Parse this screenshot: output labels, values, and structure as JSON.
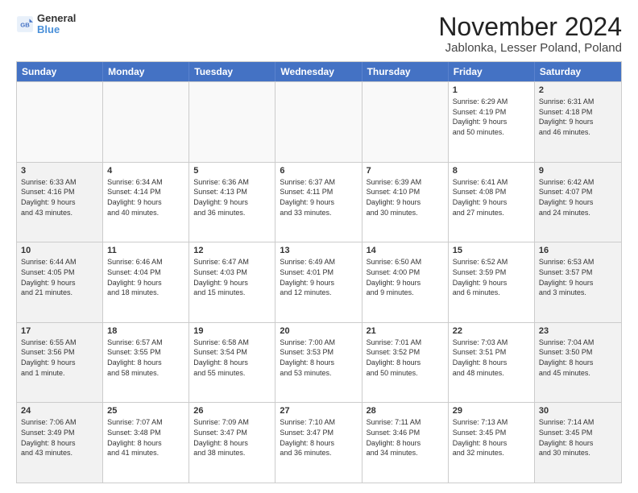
{
  "logo": {
    "line1": "General",
    "line2": "Blue"
  },
  "title": "November 2024",
  "subtitle": "Jablonka, Lesser Poland, Poland",
  "days": [
    "Sunday",
    "Monday",
    "Tuesday",
    "Wednesday",
    "Thursday",
    "Friday",
    "Saturday"
  ],
  "weeks": [
    [
      {
        "day": "",
        "text": "",
        "empty": true
      },
      {
        "day": "",
        "text": "",
        "empty": true
      },
      {
        "day": "",
        "text": "",
        "empty": true
      },
      {
        "day": "",
        "text": "",
        "empty": true
      },
      {
        "day": "",
        "text": "",
        "empty": true
      },
      {
        "day": "1",
        "text": "Sunrise: 6:29 AM\nSunset: 4:19 PM\nDaylight: 9 hours\nand 50 minutes.",
        "empty": false
      },
      {
        "day": "2",
        "text": "Sunrise: 6:31 AM\nSunset: 4:18 PM\nDaylight: 9 hours\nand 46 minutes.",
        "empty": false
      }
    ],
    [
      {
        "day": "3",
        "text": "Sunrise: 6:33 AM\nSunset: 4:16 PM\nDaylight: 9 hours\nand 43 minutes.",
        "empty": false
      },
      {
        "day": "4",
        "text": "Sunrise: 6:34 AM\nSunset: 4:14 PM\nDaylight: 9 hours\nand 40 minutes.",
        "empty": false
      },
      {
        "day": "5",
        "text": "Sunrise: 6:36 AM\nSunset: 4:13 PM\nDaylight: 9 hours\nand 36 minutes.",
        "empty": false
      },
      {
        "day": "6",
        "text": "Sunrise: 6:37 AM\nSunset: 4:11 PM\nDaylight: 9 hours\nand 33 minutes.",
        "empty": false
      },
      {
        "day": "7",
        "text": "Sunrise: 6:39 AM\nSunset: 4:10 PM\nDaylight: 9 hours\nand 30 minutes.",
        "empty": false
      },
      {
        "day": "8",
        "text": "Sunrise: 6:41 AM\nSunset: 4:08 PM\nDaylight: 9 hours\nand 27 minutes.",
        "empty": false
      },
      {
        "day": "9",
        "text": "Sunrise: 6:42 AM\nSunset: 4:07 PM\nDaylight: 9 hours\nand 24 minutes.",
        "empty": false
      }
    ],
    [
      {
        "day": "10",
        "text": "Sunrise: 6:44 AM\nSunset: 4:05 PM\nDaylight: 9 hours\nand 21 minutes.",
        "empty": false
      },
      {
        "day": "11",
        "text": "Sunrise: 6:46 AM\nSunset: 4:04 PM\nDaylight: 9 hours\nand 18 minutes.",
        "empty": false
      },
      {
        "day": "12",
        "text": "Sunrise: 6:47 AM\nSunset: 4:03 PM\nDaylight: 9 hours\nand 15 minutes.",
        "empty": false
      },
      {
        "day": "13",
        "text": "Sunrise: 6:49 AM\nSunset: 4:01 PM\nDaylight: 9 hours\nand 12 minutes.",
        "empty": false
      },
      {
        "day": "14",
        "text": "Sunrise: 6:50 AM\nSunset: 4:00 PM\nDaylight: 9 hours\nand 9 minutes.",
        "empty": false
      },
      {
        "day": "15",
        "text": "Sunrise: 6:52 AM\nSunset: 3:59 PM\nDaylight: 9 hours\nand 6 minutes.",
        "empty": false
      },
      {
        "day": "16",
        "text": "Sunrise: 6:53 AM\nSunset: 3:57 PM\nDaylight: 9 hours\nand 3 minutes.",
        "empty": false
      }
    ],
    [
      {
        "day": "17",
        "text": "Sunrise: 6:55 AM\nSunset: 3:56 PM\nDaylight: 9 hours\nand 1 minute.",
        "empty": false
      },
      {
        "day": "18",
        "text": "Sunrise: 6:57 AM\nSunset: 3:55 PM\nDaylight: 8 hours\nand 58 minutes.",
        "empty": false
      },
      {
        "day": "19",
        "text": "Sunrise: 6:58 AM\nSunset: 3:54 PM\nDaylight: 8 hours\nand 55 minutes.",
        "empty": false
      },
      {
        "day": "20",
        "text": "Sunrise: 7:00 AM\nSunset: 3:53 PM\nDaylight: 8 hours\nand 53 minutes.",
        "empty": false
      },
      {
        "day": "21",
        "text": "Sunrise: 7:01 AM\nSunset: 3:52 PM\nDaylight: 8 hours\nand 50 minutes.",
        "empty": false
      },
      {
        "day": "22",
        "text": "Sunrise: 7:03 AM\nSunset: 3:51 PM\nDaylight: 8 hours\nand 48 minutes.",
        "empty": false
      },
      {
        "day": "23",
        "text": "Sunrise: 7:04 AM\nSunset: 3:50 PM\nDaylight: 8 hours\nand 45 minutes.",
        "empty": false
      }
    ],
    [
      {
        "day": "24",
        "text": "Sunrise: 7:06 AM\nSunset: 3:49 PM\nDaylight: 8 hours\nand 43 minutes.",
        "empty": false
      },
      {
        "day": "25",
        "text": "Sunrise: 7:07 AM\nSunset: 3:48 PM\nDaylight: 8 hours\nand 41 minutes.",
        "empty": false
      },
      {
        "day": "26",
        "text": "Sunrise: 7:09 AM\nSunset: 3:47 PM\nDaylight: 8 hours\nand 38 minutes.",
        "empty": false
      },
      {
        "day": "27",
        "text": "Sunrise: 7:10 AM\nSunset: 3:47 PM\nDaylight: 8 hours\nand 36 minutes.",
        "empty": false
      },
      {
        "day": "28",
        "text": "Sunrise: 7:11 AM\nSunset: 3:46 PM\nDaylight: 8 hours\nand 34 minutes.",
        "empty": false
      },
      {
        "day": "29",
        "text": "Sunrise: 7:13 AM\nSunset: 3:45 PM\nDaylight: 8 hours\nand 32 minutes.",
        "empty": false
      },
      {
        "day": "30",
        "text": "Sunrise: 7:14 AM\nSunset: 3:45 PM\nDaylight: 8 hours\nand 30 minutes.",
        "empty": false
      }
    ]
  ]
}
